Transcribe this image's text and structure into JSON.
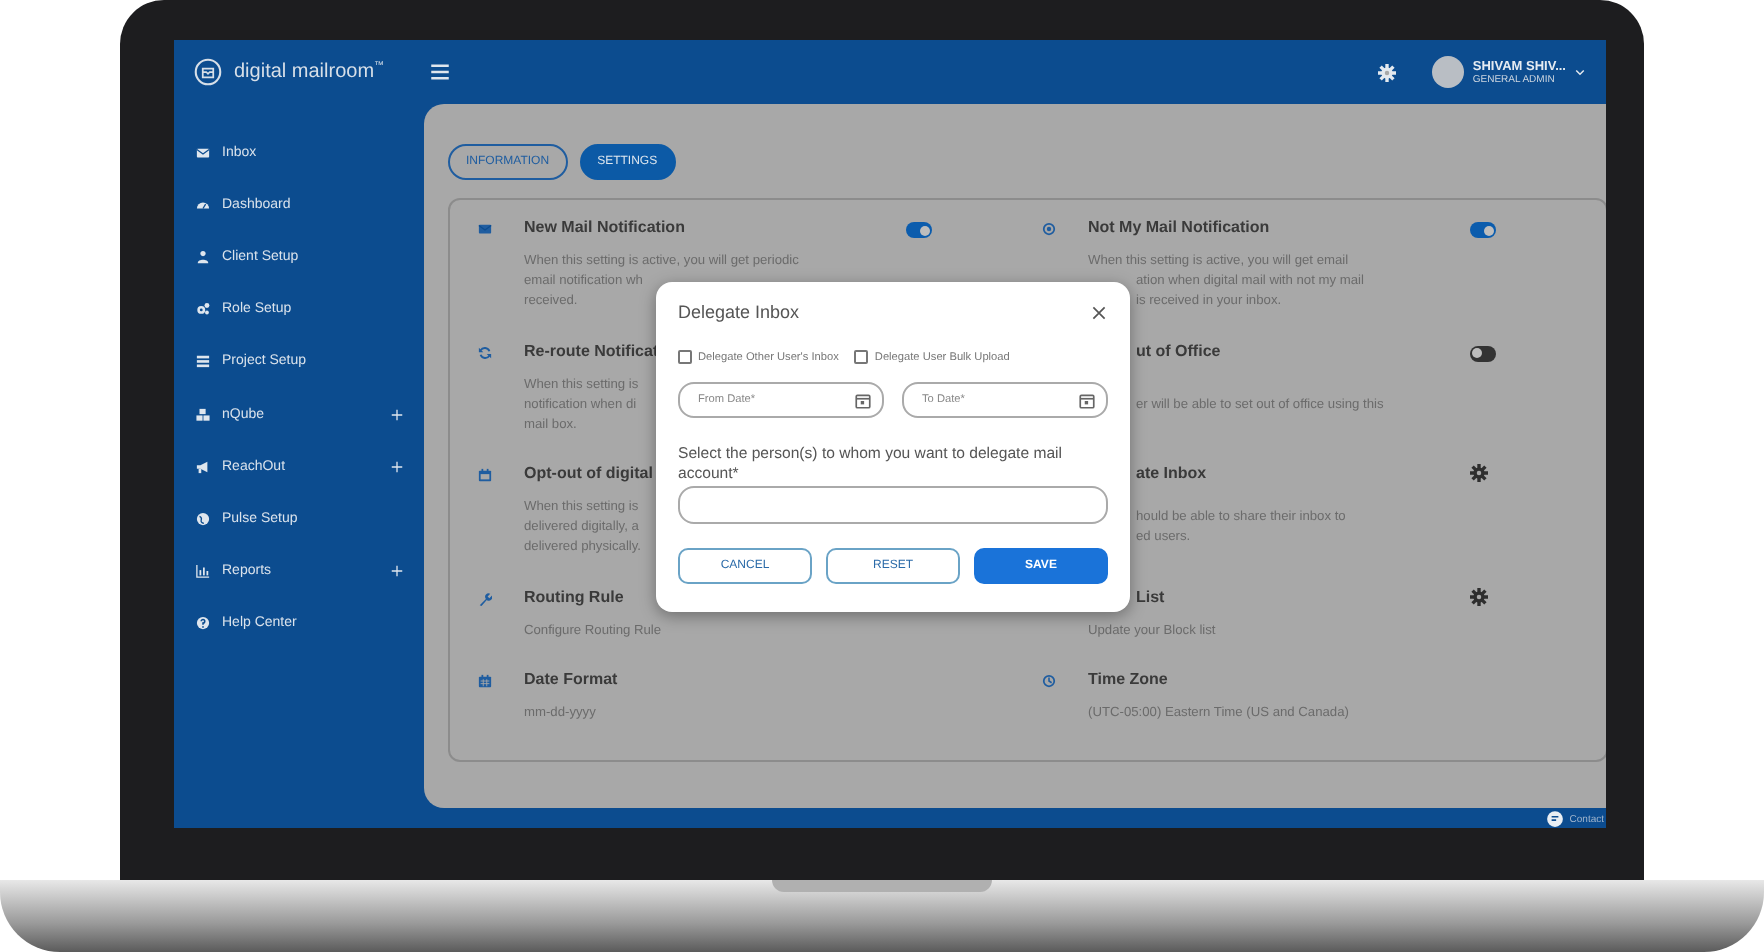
{
  "header": {
    "logo": "digital mailroom$^{™}$",
    "user_name": "SHIVAM SHIV...",
    "user_role": "GENERAL ADMIN"
  },
  "sidebar": {
    "items": [
      {
        "label": "Inbox",
        "expandable": false
      },
      {
        "label": "Dashboard",
        "expandable": false
      },
      {
        "label": "Client Setup",
        "expandable": false
      },
      {
        "label": "Role Setup",
        "expandable": false
      },
      {
        "label": "Project Setup",
        "expandable": false
      },
      {
        "label": "nQube",
        "expandable": true
      },
      {
        "label": "ReachOut",
        "expandable": true
      },
      {
        "label": "Pulse Setup",
        "expandable": false
      },
      {
        "label": "Reports",
        "expandable": true
      },
      {
        "label": "Help Center",
        "expandable": false
      }
    ]
  },
  "tabs": [
    {
      "label": "INFORMATION",
      "selected": false
    },
    {
      "label": "SETTINGS",
      "selected": true
    }
  ],
  "settings_left": [
    {
      "title": "New Mail Notification",
      "kind": "toggle",
      "on": true,
      "lines": [
        {
          "text": "When this setting is active, you will get periodic"
        },
        {
          "text": "email notification wh"
        },
        {
          "text": "received."
        }
      ]
    },
    {
      "title": "Re-route Notificat",
      "kind": "plain",
      "lines": [
        {
          "text": "When this setting is"
        },
        {
          "text": "notification when di"
        },
        {
          "text": "mail box."
        }
      ]
    },
    {
      "title": "Opt-out of digital",
      "kind": "plain",
      "lines": [
        {
          "text": "When this setting is"
        },
        {
          "text": "delivered digitally, a"
        },
        {
          "text": "delivered physically."
        }
      ]
    },
    {
      "title": "Routing Rule",
      "kind": "plain",
      "lines": [
        {
          "text": "Configure Routing Rule"
        }
      ]
    },
    {
      "title": "Date Format",
      "kind": "plain",
      "lines": [
        {
          "text": "mm-dd-yyyy"
        }
      ]
    }
  ],
  "settings_right": [
    {
      "title": "Not My Mail Notification",
      "kind": "toggle",
      "on": true,
      "lines": [
        {
          "text": "When this setting is active, you will get email"
        },
        {
          "text": "ation when digital mail with not my mail",
          "covered": true
        },
        {
          "text": "is received in your inbox.",
          "covered": true
        }
      ]
    },
    {
      "title": "ut of Office",
      "title_covered": true,
      "kind": "toggle",
      "on": false,
      "lines": [
        {
          "text": "er will be able to set out of office using this",
          "covered": true
        }
      ]
    },
    {
      "title": "ate Inbox",
      "title_covered": true,
      "kind": "gear",
      "lines": [
        {
          "text": "hould be able to share their inbox to",
          "covered": true
        },
        {
          "text": "ed users.",
          "covered": true
        }
      ]
    },
    {
      "title": "List",
      "title_covered": true,
      "kind": "gear",
      "lines": [
        {
          "text": "Update your Block list"
        }
      ]
    },
    {
      "title": "Time Zone",
      "kind": "plain",
      "lines": [
        {
          "text": "(UTC-05:00) Eastern Time (US and Canada)"
        }
      ]
    }
  ],
  "dialog": {
    "title": "Delegate Inbox",
    "checkboxes": [
      {
        "label": "Delegate Other User's Inbox",
        "checked": false
      },
      {
        "label": "Delegate User Bulk Upload",
        "checked": false
      }
    ],
    "date_fields": [
      {
        "placeholder": "From Date*"
      },
      {
        "placeholder": "To Date*"
      }
    ],
    "person_label": "Select the person(s) to whom you want to delegate mail account*",
    "buttons": [
      {
        "label": "CANCEL",
        "kind": "outlined"
      },
      {
        "label": "RESET",
        "kind": "outlined"
      },
      {
        "label": "SAVE",
        "kind": "primary"
      }
    ]
  },
  "contact_label": "Contact"
}
